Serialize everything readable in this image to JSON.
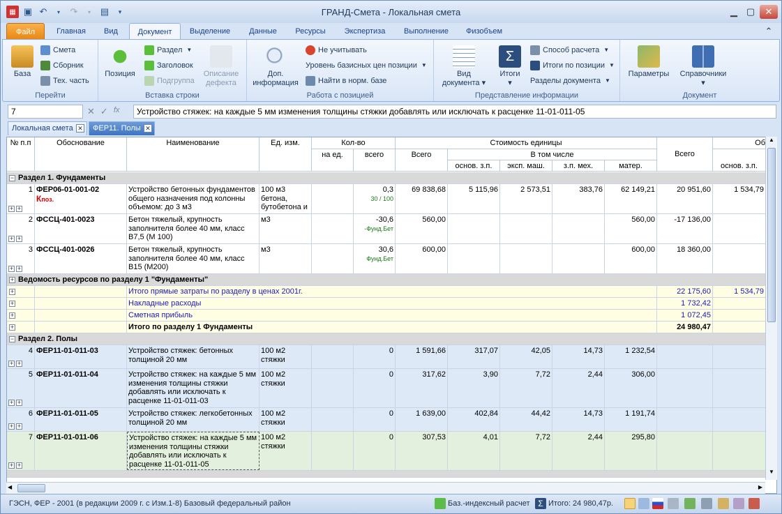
{
  "window": {
    "title": "ГРАНД-Смета - Локальная смета"
  },
  "ribbon_tabs": [
    "Файл",
    "Главная",
    "Вид",
    "Документ",
    "Выделение",
    "Данные",
    "Ресурсы",
    "Экспертиза",
    "Выполнение",
    "Физобъем"
  ],
  "ribbon": {
    "go": {
      "label": "Перейти",
      "base": "База",
      "smeta": "Смета",
      "sbornik": "Сборник",
      "teh": "Тех. часть"
    },
    "insert": {
      "label": "Вставка строки",
      "pos": "Позиция",
      "razdel": "Раздел",
      "zagolovok": "Заголовок",
      "podgruppa": "Подгруппа",
      "opisanie1": "Описание",
      "opisanie2": "дефекта"
    },
    "work": {
      "label": "Работа с позицией",
      "dop1": "Доп.",
      "dop2": "информация",
      "ne_uchit": "Не учитывать",
      "uroven": "Уровень базисных цен позиции",
      "nayti": "Найти в норм. базе"
    },
    "view": {
      "label": "Представление информации",
      "vid1": "Вид",
      "vid2": "документа",
      "itogi": "Итоги",
      "sposob": "Способ расчета",
      "itogi_pos": "Итоги по позиции",
      "razdely": "Разделы документа"
    },
    "doc": {
      "label": "Документ",
      "params": "Параметры",
      "sprav": "Справочники"
    }
  },
  "formula": {
    "cell": "7",
    "fx": "fx",
    "text": "Устройство стяжек: на каждые 5 мм изменения толщины стяжки добавлять или исключать к расценке 11-01-011-05"
  },
  "doc_tabs": [
    "Локальная смета",
    "ФЕР11. Полы"
  ],
  "columns": {
    "num": "№ п.п",
    "obosn": "Обоснование",
    "name": "Наименование",
    "ed": "Ед. изм.",
    "kol": "Кол-во",
    "na_ed": "на ед.",
    "vsego": "всего",
    "stoim": "Стоимость единицы",
    "s_vsego": "Всего",
    "vtom": "В том числе",
    "osn": "основ. з.п.",
    "eksp": "эксп. маш.",
    "zpmeh": "з.п. мех.",
    "mater": "матер.",
    "obsh_vsego": "Всего",
    "ob": "Об",
    "obsh_osn": "основ. з.п."
  },
  "rows": [
    {
      "type": "section",
      "text": "Раздел 1. Фундаменты"
    },
    {
      "type": "pos",
      "n": "1",
      "code": "ФЕР06-01-001-02",
      "k": "К",
      "kpoz": "поз.",
      "name": "Устройство бетонных фундаментов общего назначения под колонны объемом: до 3 м3",
      "ed": "100 м3 бетона, бутобетона и",
      "vsego": "0,3",
      "sub": "30 / 100",
      "sv": "69 838,68",
      "osn": "5 115,96",
      "eksp": "2 573,51",
      "zpm": "383,76",
      "mat": "62 149,21",
      "ov": "20 951,60",
      "oo": "1 534,79"
    },
    {
      "type": "pos",
      "n": "2",
      "code": "ФССЦ-401-0023",
      "name": "Бетон тяжелый, крупность заполнителя более 40 мм, класс В7,5 (М 100)",
      "ed": "м3",
      "vsego": "-30,6",
      "sub": "-Фунд.Бет",
      "sv": "560,00",
      "osn": "",
      "eksp": "",
      "zpm": "",
      "mat": "560,00",
      "ov": "-17 136,00",
      "oo": ""
    },
    {
      "type": "pos",
      "n": "3",
      "code": "ФССЦ-401-0026",
      "name": "Бетон тяжелый, крупность заполнителя более 40 мм, класс В15 (М200)",
      "ed": "м3",
      "vsego": "30,6",
      "sub": "Фунд.Бет",
      "sv": "600,00",
      "osn": "",
      "eksp": "",
      "zpm": "",
      "mat": "600,00",
      "ov": "18 360,00",
      "oo": ""
    },
    {
      "type": "section",
      "text": "Ведомость ресурсов по разделу 1 \"Фундаменты\""
    },
    {
      "type": "total",
      "text": "Итого прямые затраты по разделу в ценах 2001г.",
      "ov": "22 175,60",
      "oo": "1 534,79"
    },
    {
      "type": "total",
      "text": "Накладные расходы",
      "ov": "1 732,42",
      "oo": ""
    },
    {
      "type": "total",
      "text": "Сметная прибыль",
      "ov": "1 072,45",
      "oo": ""
    },
    {
      "type": "grand",
      "text": "Итого по разделу 1 Фундаменты",
      "ov": "24 980,47"
    },
    {
      "type": "section",
      "text": "Раздел 2. Полы"
    },
    {
      "type": "pos2",
      "n": "4",
      "code": "ФЕР11-01-011-03",
      "name": "Устройство стяжек: бетонных толщиной 20 мм",
      "ed": "100 м2 стяжки",
      "vsego": "0",
      "sv": "1 591,66",
      "osn": "317,07",
      "eksp": "42,05",
      "zpm": "14,73",
      "mat": "1 232,54"
    },
    {
      "type": "pos2",
      "n": "5",
      "code": "ФЕР11-01-011-04",
      "name": "Устройство стяжек: на каждые 5 мм изменения толщины стяжки добавлять или исключать к расценке 11-01-011-03",
      "ed": "100 м2 стяжки",
      "vsego": "0",
      "sv": "317,62",
      "osn": "3,90",
      "eksp": "7,72",
      "zpm": "2,44",
      "mat": "306,00"
    },
    {
      "type": "pos2",
      "n": "6",
      "code": "ФЕР11-01-011-05",
      "name": "Устройство стяжек: легкобетонных толщиной 20 мм",
      "ed": "100 м2 стяжки",
      "vsego": "0",
      "sv": "1 639,00",
      "osn": "402,84",
      "eksp": "44,42",
      "zpm": "14,73",
      "mat": "1 191,74"
    },
    {
      "type": "pos3",
      "n": "7",
      "code": "ФЕР11-01-011-06",
      "name": "Устройство стяжек: на каждые 5 мм изменения толщины стяжки добавлять или исключать к расценке 11-01-011-05",
      "ed": "100 м2 стяжки",
      "vsego": "0",
      "sv": "307,53",
      "osn": "4,01",
      "eksp": "7,72",
      "zpm": "2,44",
      "mat": "295,80"
    }
  ],
  "status": {
    "left": "ГЭСН, ФЕР - 2001 (в редакции 2009 г. с Изм.1-8)   Базовый федеральный район",
    "calc": "Баз.-индексный расчет",
    "itog": "Итого: 24 980,47р."
  }
}
